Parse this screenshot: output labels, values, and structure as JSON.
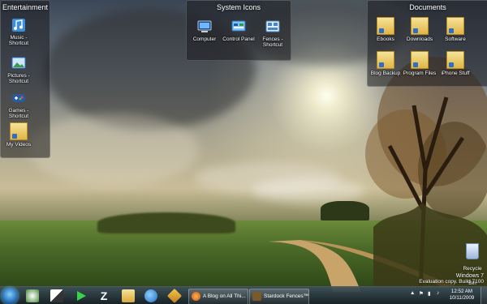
{
  "desktop": {
    "fences": {
      "entertainment": {
        "title": "Entertainment",
        "icons": [
          {
            "label": "Music - Shortcut",
            "icon": "music-icon"
          },
          {
            "label": "Pictures - Shortcut",
            "icon": "pictures-icon"
          },
          {
            "label": "Games - Shortcut",
            "icon": "games-icon"
          },
          {
            "label": "My Videos",
            "icon": "folder-icon"
          }
        ]
      },
      "system": {
        "title": "System Icons",
        "icons": [
          {
            "label": "Computer",
            "icon": "computer-icon"
          },
          {
            "label": "Control Panel",
            "icon": "control-panel-icon"
          },
          {
            "label": "Fences - Shortcut",
            "icon": "fences-icon"
          }
        ]
      },
      "documents": {
        "title": "Documents",
        "icons": [
          {
            "label": "Ebooks",
            "icon": "folder-icon"
          },
          {
            "label": "Downloads",
            "icon": "folder-icon"
          },
          {
            "label": "Software",
            "icon": "folder-icon"
          },
          {
            "label": "Blog Backup",
            "icon": "folder-icon"
          },
          {
            "label": "Program Files",
            "icon": "folder-icon"
          },
          {
            "label": "iPhone Stuff",
            "icon": "folder-icon"
          }
        ]
      }
    },
    "recycle_bin": {
      "label": "Recycle Bin",
      "icon": "recycle-bin-icon"
    },
    "watermark": {
      "line1": "Windows 7",
      "line2": "Evaluation copy. Build 7100"
    }
  },
  "taskbar": {
    "pinned": [
      {
        "name": "start-orb-icon"
      },
      {
        "name": "media-center-icon"
      },
      {
        "name": "switch-windows-icon"
      },
      {
        "name": "play-icon"
      },
      {
        "name": "z-app-icon"
      },
      {
        "name": "explorer-icon"
      },
      {
        "name": "internet-explorer-icon"
      },
      {
        "name": "tools-icon"
      }
    ],
    "tasks": [
      {
        "label": "A Blog on All Thi...",
        "icon": "firefox-icon"
      },
      {
        "label": "Stardock Fences™",
        "icon": "fences-icon"
      }
    ],
    "clock": {
      "time": "12:52 AM",
      "date": "10/11/2009"
    }
  },
  "colors": {
    "taskbar": "#1e2d33",
    "fence_bg": "#191920",
    "start_orb": "#1d5fa8"
  }
}
